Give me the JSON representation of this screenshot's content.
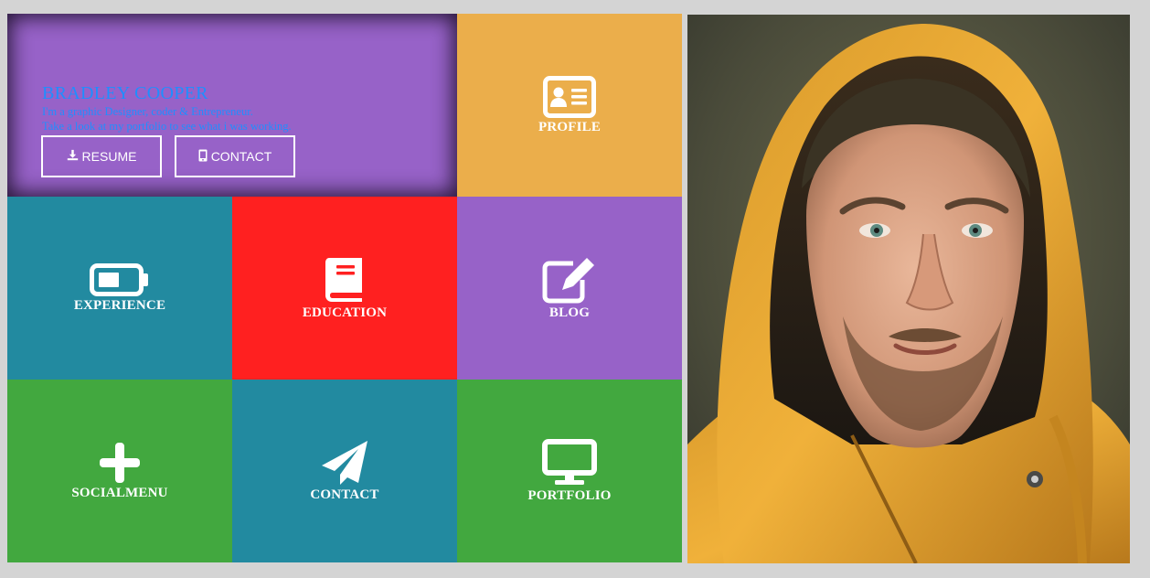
{
  "hero": {
    "name": "BRADLEY COOPER",
    "line1": "I'm a graphic Designer, coder & Entrepreneur.",
    "line2": "Take a look at my portfolio to see what i was working.",
    "resume_label": "RESUME",
    "contact_label": "CONTACT"
  },
  "tiles": {
    "profile": "PROFILE",
    "experience": "EXPERIENCE",
    "education": "EDUCATION",
    "blog": "BLOG",
    "socialmenu": "SOCIALMENU",
    "contact": "CONTACT",
    "portfolio": "PORTFOLIO"
  },
  "colors": {
    "purple": "#9762c8",
    "orange": "#ebae4b",
    "teal": "#228aa0",
    "red": "#ff2020",
    "green": "#42a83f",
    "hero_text": "#1e8fff",
    "background": "#d4d4d4"
  },
  "icons": {
    "profile": "id-card-icon",
    "experience": "battery-icon",
    "education": "book-icon",
    "blog": "edit-icon",
    "socialmenu": "plus-icon",
    "contact": "paper-plane-icon",
    "portfolio": "monitor-icon",
    "resume": "download-icon",
    "contact_button": "mobile-icon"
  }
}
